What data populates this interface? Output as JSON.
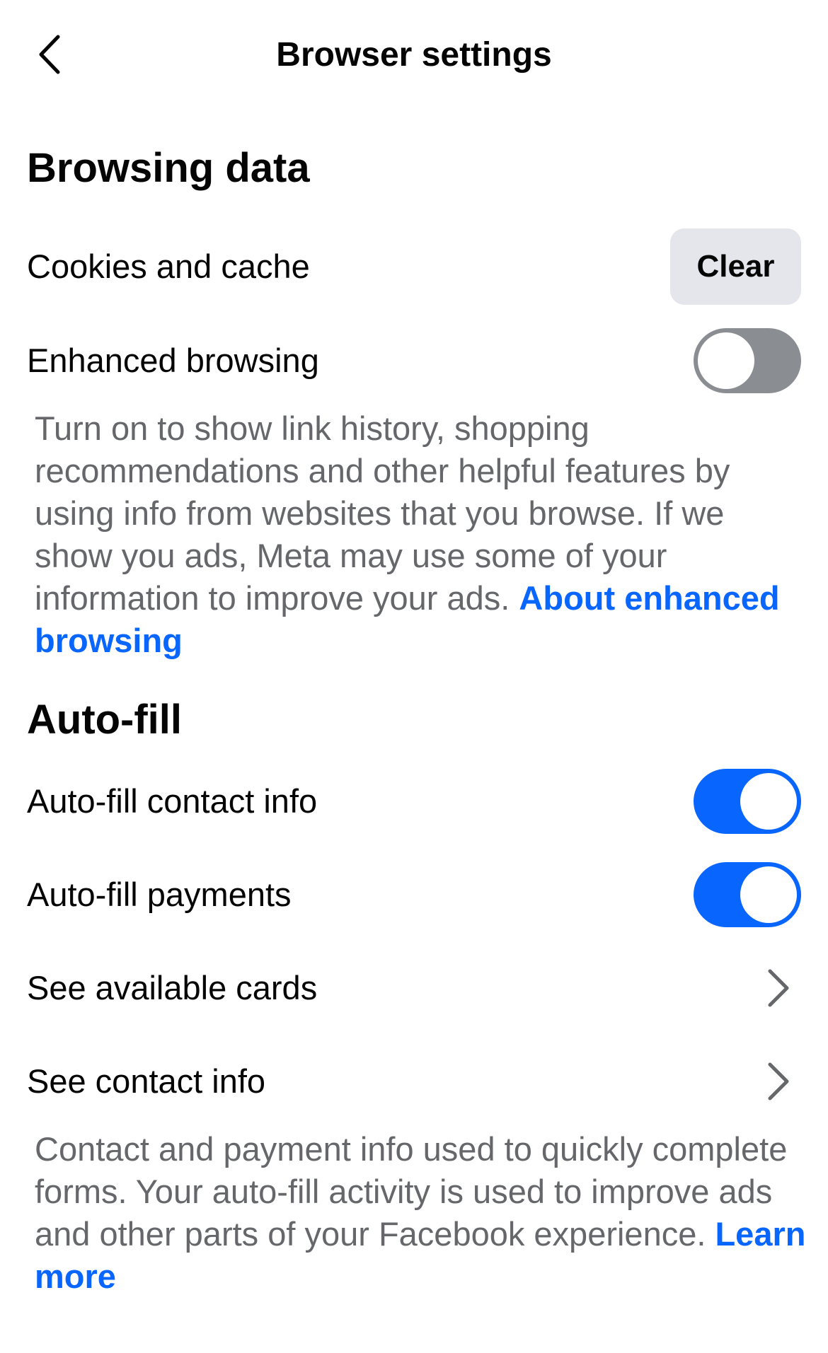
{
  "header": {
    "title": "Browser settings",
    "back_icon": "chevron-left-icon"
  },
  "browsing_data": {
    "heading": "Browsing data",
    "cookies_label": "Cookies and cache",
    "clear_label": "Clear",
    "enhanced_label": "Enhanced browsing",
    "enhanced_on": false,
    "enhanced_description": "Turn on to show link history, shopping recommendations and other helpful features by using info from websites that you browse. If we show you ads, Meta may use some of your information to improve your ads.",
    "enhanced_link": "About enhanced browsing"
  },
  "autofill": {
    "heading": "Auto-fill",
    "contact_label": "Auto-fill contact info",
    "contact_on": true,
    "payments_label": "Auto-fill payments",
    "payments_on": true,
    "cards_label": "See available cards",
    "contact_info_label": "See contact info",
    "description": "Contact and payment info used to quickly complete forms. Your auto-fill activity is used to improve ads and other parts of your Facebook experience.",
    "learn_more": "Learn more"
  },
  "colors": {
    "accent": "#0866ff",
    "toggle_off": "#8a8d91",
    "secondary_text": "#65676b",
    "button_bg": "#e4e6eb"
  }
}
